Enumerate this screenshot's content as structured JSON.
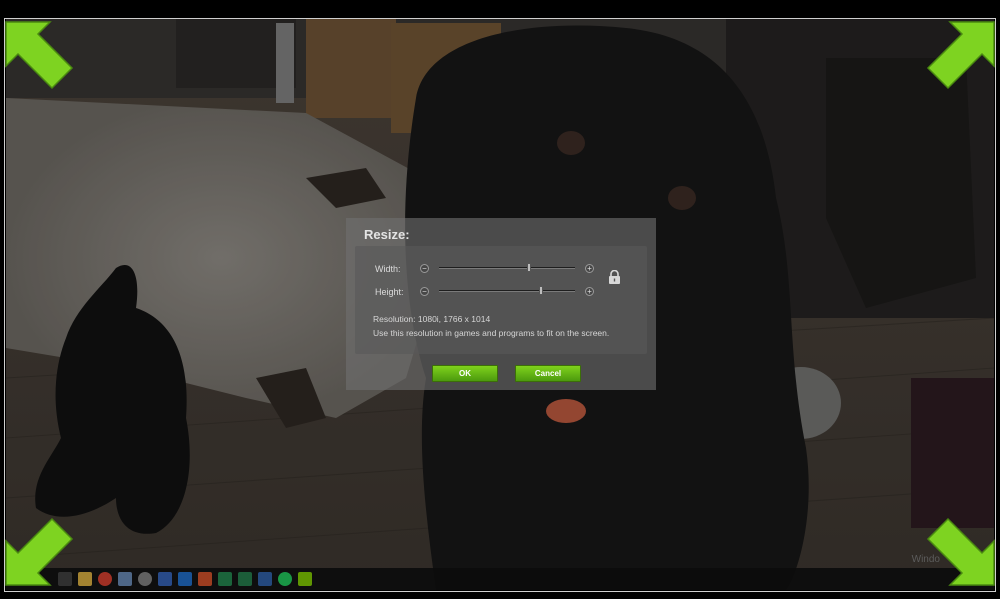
{
  "dialog": {
    "title": "Resize:",
    "width_label": "Width:",
    "height_label": "Height:",
    "width_slider_level": 0.67,
    "height_slider_level": 0.76,
    "decrease_glyph": "−",
    "increase_glyph": "+",
    "resolution_text": "Resolution: 1080i, 1766 x 1014",
    "hint_text": "Use this resolution in games and programs to fit on the screen.",
    "ok_label": "OK",
    "cancel_label": "Cancel"
  },
  "desktop": {
    "watermark": "Windo"
  },
  "taskbar": {
    "icons": [
      "start-icon",
      "file-explorer-icon",
      "chrome-icon",
      "app-icon",
      "settings-icon",
      "app-icon",
      "outlook-icon",
      "powerpoint-icon",
      "app-icon",
      "excel-icon",
      "word-icon",
      "spotify-icon",
      "nvidia-icon"
    ]
  },
  "colors": {
    "accent_green": "#6cc417",
    "corner_arrow_green": "#7ed321"
  }
}
